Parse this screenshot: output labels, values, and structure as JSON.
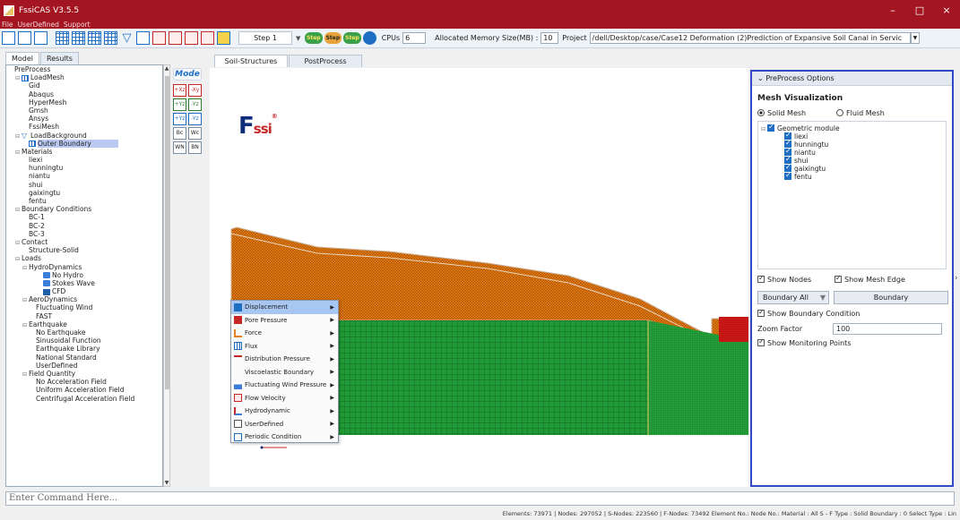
{
  "window": {
    "title": "FssiCAS V3.5.5",
    "min": "–",
    "max": "□",
    "close": "×"
  },
  "menu": [
    "File",
    "UserDefined",
    "Support"
  ],
  "toolbar": {
    "step_label": "Step 1",
    "pill_labels": [
      "Step",
      "Step",
      "Step"
    ],
    "cpus_label": "CPUs",
    "cpus_value": "6",
    "memory_label": "Allocated Memory Size(MB) :",
    "memory_value": "10",
    "project_label": "Project",
    "project_path": "/dell/Desktop/case/Case12 Deformation (2)Prediction of Expansive Soil Canal in Servic"
  },
  "left_tabs": [
    "Model",
    "Results"
  ],
  "tree": [
    {
      "label": "PreProcess",
      "level": 0,
      "exp": ""
    },
    {
      "label": "LoadMesh",
      "level": 1,
      "exp": "⊟",
      "icon": "mesh"
    },
    {
      "label": "Gid",
      "level": 2
    },
    {
      "label": "Abaqus",
      "level": 2
    },
    {
      "label": "HyperMesh",
      "level": 2
    },
    {
      "label": "Gmsh",
      "level": 2
    },
    {
      "label": "Ansys",
      "level": 2
    },
    {
      "label": "FssiMesh",
      "level": 2
    },
    {
      "label": "LoadBackground",
      "level": 1,
      "exp": "⊟",
      "icon": "filter"
    },
    {
      "label": "Outer Boundary",
      "level": 2,
      "selected": true,
      "icon": "mesh"
    },
    {
      "label": "Materials",
      "level": 1,
      "exp": "⊟"
    },
    {
      "label": "liexi",
      "level": 2
    },
    {
      "label": "hunningtu",
      "level": 2
    },
    {
      "label": "niantu",
      "level": 2
    },
    {
      "label": "shui",
      "level": 2
    },
    {
      "label": "gaixingtu",
      "level": 2
    },
    {
      "label": "fentu",
      "level": 2
    },
    {
      "label": "Boundary Conditions",
      "level": 1,
      "exp": "⊟"
    },
    {
      "label": "BC-1",
      "level": 2
    },
    {
      "label": "BC-2",
      "level": 2
    },
    {
      "label": "BC-3",
      "level": 2
    },
    {
      "label": "Contact",
      "level": 1,
      "exp": "⊟"
    },
    {
      "label": "Structure-Solid",
      "level": 2
    },
    {
      "label": "Loads",
      "level": 1,
      "exp": "⊟"
    },
    {
      "label": "HydroDynamics",
      "level": 2,
      "exp": "⊟"
    },
    {
      "label": "No Hydro",
      "level": 4,
      "icon": "wave"
    },
    {
      "label": "Stokes Wave",
      "level": 4,
      "icon": "wave"
    },
    {
      "label": "CFD",
      "level": 4,
      "icon": "cfd"
    },
    {
      "label": "AeroDynamics",
      "level": 2,
      "exp": "⊟"
    },
    {
      "label": "Fluctuating Wind",
      "level": 3
    },
    {
      "label": "FAST",
      "level": 3
    },
    {
      "label": "Earthquake",
      "level": 2,
      "exp": "⊟"
    },
    {
      "label": "No Earthquake",
      "level": 3
    },
    {
      "label": "Sinusoidal Function",
      "level": 3
    },
    {
      "label": "Earthquake Library",
      "level": 3
    },
    {
      "label": "National Standard",
      "level": 3
    },
    {
      "label": "UserDefined",
      "level": 3
    },
    {
      "label": "Field Quantity",
      "level": 2,
      "exp": "⊟"
    },
    {
      "label": "No Acceleration Field",
      "level": 3
    },
    {
      "label": "Uniform Acceleration Field",
      "level": 3
    },
    {
      "label": "Centrifugal Acceleration Field",
      "level": 3
    }
  ],
  "mode_button": "Mode",
  "axis_buttons": [
    "+Xz",
    "-Xy",
    "+Yz",
    "-Yz",
    "+Yz",
    "-Yz",
    "Bc",
    "Wc",
    "WN",
    "BN"
  ],
  "center_tabs": [
    "Soil-Structures",
    "PostProcess"
  ],
  "logo": {
    "main": "F",
    "sub": "ssi",
    "reg": "®"
  },
  "context_menu": [
    {
      "label": "Displacement",
      "icon": "blue",
      "highlight": true
    },
    {
      "label": "Pore Pressure",
      "icon": "red"
    },
    {
      "label": "Force",
      "icon": "orange"
    },
    {
      "label": "Flux",
      "icon": "grid"
    },
    {
      "label": "Distribution Pressure",
      "icon": "arrows"
    },
    {
      "label": "Viscoelastic Boundary",
      "icon": "none"
    },
    {
      "label": "Fluctuating Wind Pressure",
      "icon": "wave"
    },
    {
      "label": "Flow Velocity",
      "icon": "flow"
    },
    {
      "label": "Hydrodynamic",
      "icon": "hydro"
    },
    {
      "label": "UserDefined",
      "icon": "xml"
    },
    {
      "label": "Periodic Condition",
      "icon": "period"
    }
  ],
  "right_panel": {
    "header": "PreProcess Options",
    "title": "Mesh Visualization",
    "radio_solid": "Solid Mesh",
    "radio_fluid": "Fluid Mesh",
    "geometric_module": "Geometric module",
    "modules": [
      "liexi",
      "hunningtu",
      "niantu",
      "shui",
      "gaixingtu",
      "fentu"
    ],
    "show_nodes": "Show Nodes",
    "show_mesh_edge": "Show Mesh Edge",
    "boundary_combo": "Boundary All",
    "boundary_button": "Boundary",
    "show_boundary": "Show Boundary Condition",
    "zoom_label": "Zoom Factor",
    "zoom_value": "100",
    "show_monitoring": "Show Monitoring Points"
  },
  "command_placeholder": "Enter Command Here...",
  "status": "Elements: 73971 | Nodes: 297052 | S-Nodes: 223560 | F-Nodes: 73492 Element No.: Node No.: Material : All  S - F Type : Solid  Boundary : 0  Select Type : Lin"
}
